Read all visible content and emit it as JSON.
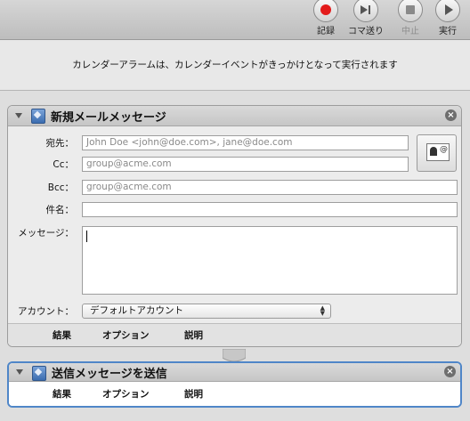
{
  "toolbar": {
    "buttons": [
      {
        "label": "記録",
        "icon": "record-icon",
        "enabled": true
      },
      {
        "label": "コマ送り",
        "icon": "step-icon",
        "enabled": true
      },
      {
        "label": "中止",
        "icon": "stop-icon",
        "enabled": false
      },
      {
        "label": "実行",
        "icon": "run-icon",
        "enabled": true
      }
    ]
  },
  "description": "カレンダーアラームは、カレンダーイベントがきっかけとなって実行されます",
  "actions": [
    {
      "title": "新規メールメッセージ",
      "form": {
        "to_label": "宛先：",
        "to_value": "John Doe <john@doe.com>, jane@doe.com",
        "cc_label": "Cc：",
        "cc_value": "group@acme.com",
        "bcc_label": "Bcc：",
        "bcc_value": "group@acme.com",
        "subject_label": "件名：",
        "subject_value": "",
        "message_label": "メッセージ：",
        "message_value": "",
        "account_label": "アカウント：",
        "account_value": "デフォルトアカウント"
      },
      "tabs": [
        "結果",
        "オプション",
        "説明"
      ]
    },
    {
      "title": "送信メッセージを送信",
      "tabs": [
        "結果",
        "オプション",
        "説明"
      ],
      "selected": true
    }
  ],
  "colors": {
    "accent": "#4f86c8",
    "record": "#e31b1b"
  }
}
